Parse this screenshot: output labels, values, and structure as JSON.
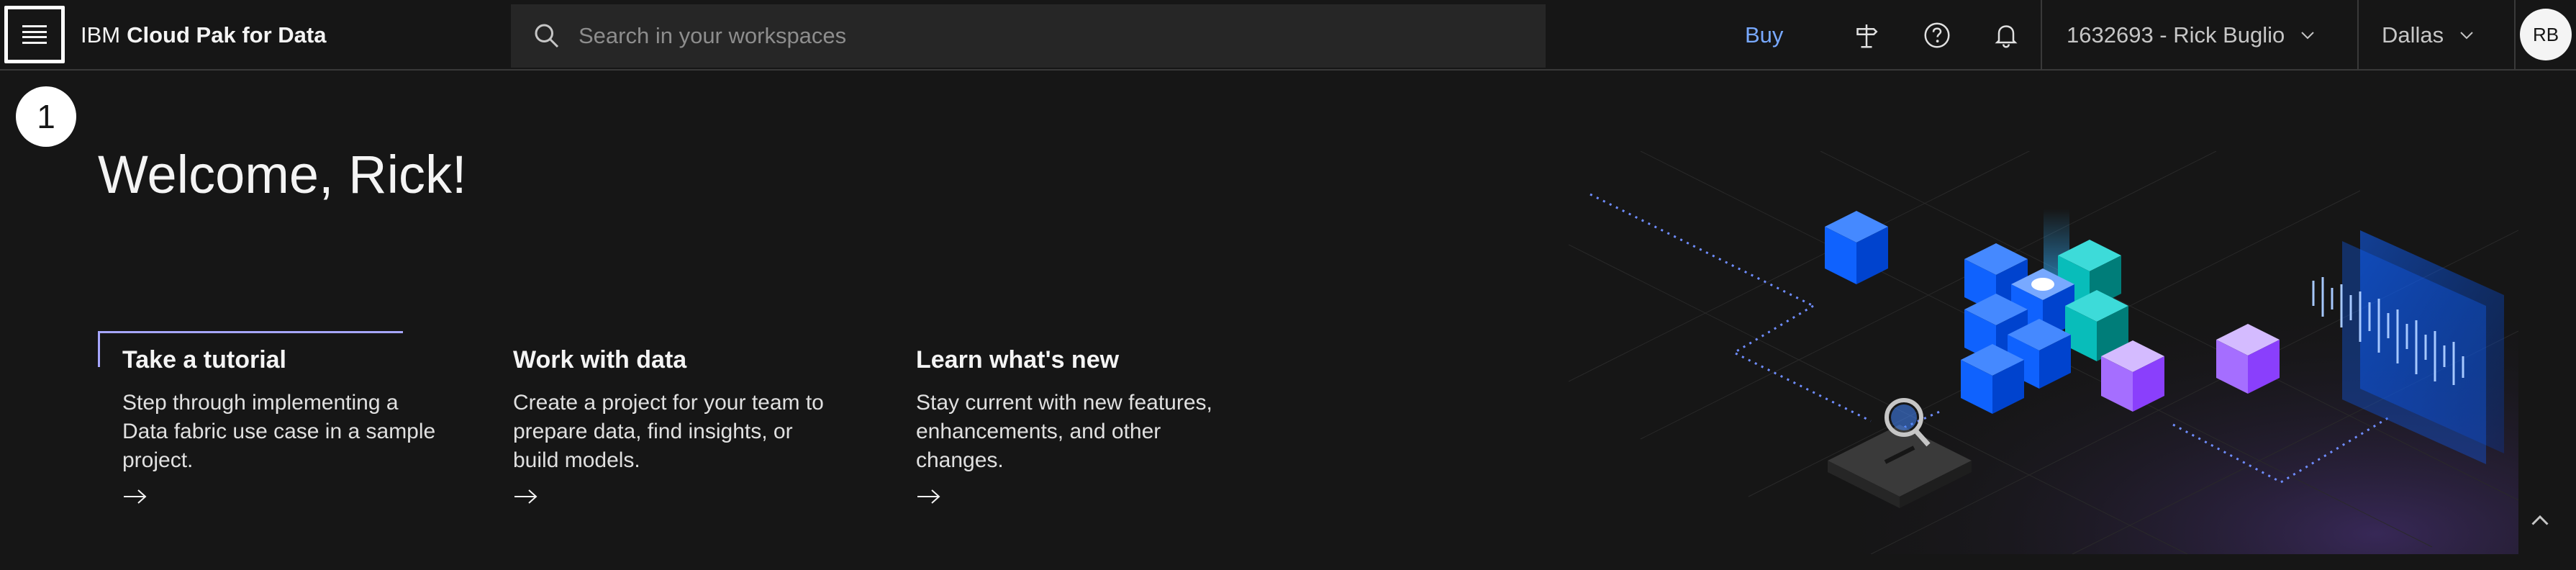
{
  "header": {
    "brand_prefix": "IBM",
    "brand_product": "Cloud Pak for Data",
    "search_placeholder": "Search in your workspaces",
    "buy_label": "Buy",
    "account_label": "1632693 - Rick Buglio",
    "region_label": "Dallas",
    "avatar_initials": "RB",
    "icons": [
      "menu-icon",
      "search-icon",
      "signpost-icon",
      "help-icon",
      "notification-icon",
      "chevron-down-icon"
    ]
  },
  "main": {
    "step_badge": "1",
    "welcome": "Welcome, Rick!",
    "cards": [
      {
        "title": "Take a tutorial",
        "text": "Step through implementing a Data fabric use case in a sample project.",
        "selected": true
      },
      {
        "title": "Work with data",
        "text": "Create a project for your team to prepare data, find insights, or build models."
      },
      {
        "title": "Learn what's new",
        "text": "Stay current with new features, enhancements, and other changes."
      }
    ]
  },
  "colors": {
    "background": "#161616",
    "search_bg": "#262626",
    "link": "#78a9ff",
    "accent_purple": "#a6a6ff",
    "cube_blue": "#0f62fe",
    "cube_teal": "#08bdba",
    "cube_purple": "#a56eff"
  }
}
